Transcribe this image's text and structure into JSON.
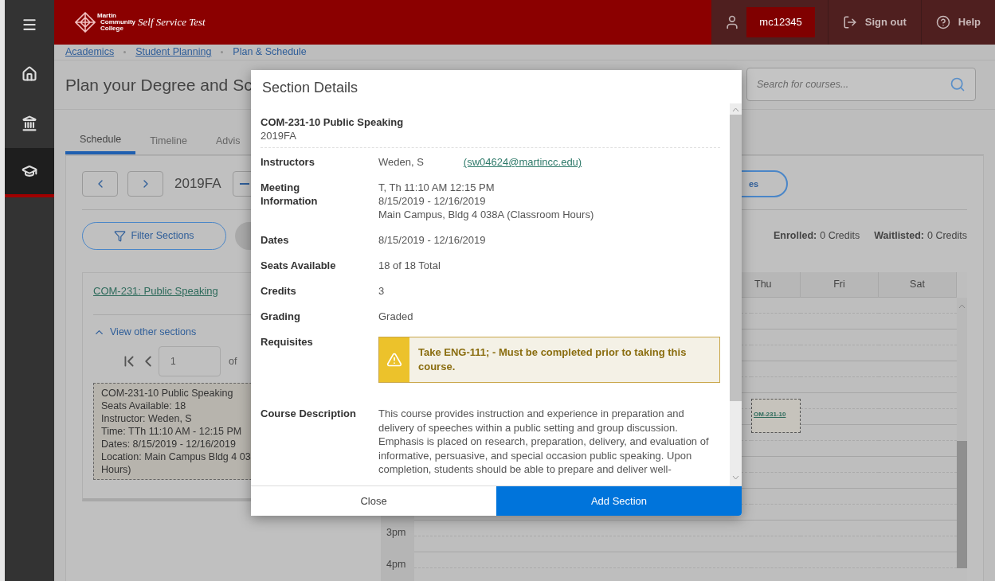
{
  "sidebar": {
    "items": [
      {
        "kind": "menu",
        "selected": false
      },
      {
        "kind": "home",
        "selected": false
      },
      {
        "kind": "institution",
        "selected": false
      },
      {
        "kind": "academics",
        "selected": true
      }
    ]
  },
  "header": {
    "logo_lines": [
      "Martin",
      "Community",
      "College"
    ],
    "app_name": "Self Service Test",
    "user": "mc12345",
    "sign_out": "Sign out",
    "help": "Help"
  },
  "breadcrumbs": [
    {
      "label": "Academics",
      "selected": false
    },
    {
      "label": "Student Planning",
      "selected": false
    },
    {
      "label": "Plan & Schedule",
      "selected": true
    }
  ],
  "page_title": "Plan your Degree and Sc",
  "search": {
    "placeholder": "Search for courses..."
  },
  "tabs": [
    {
      "label": "Schedule",
      "selected": true
    },
    {
      "label": "Timeline",
      "selected": false
    },
    {
      "label": "Advis",
      "selected": false
    }
  ],
  "term": "2019FA",
  "partial_button": "es",
  "filter_button": "Filter Sections",
  "credits": [
    {
      "label": "Enrolled:",
      "value": "0 Credits"
    },
    {
      "label": "Waitlisted:",
      "value": "0 Credits"
    }
  ],
  "course_card": {
    "title": "COM-231: Public Speaking",
    "toggle": "View other sections",
    "expanded": true,
    "page": "1",
    "page_of": "of",
    "section_lines": [
      "COM-231-10 Public Speaking",
      "Seats Available: 18",
      "Instructor: Weden, S",
      "Time: TTh 11:10 AM - 12:15 PM",
      "Dates: 8/15/2019 - 12/16/2019",
      "Location: Main Campus Bldg 4 03",
      "Hours)"
    ]
  },
  "calendar": {
    "days": [
      {
        "label": "Thu",
        "events": [
          {
            "label": "OM-231-10"
          }
        ]
      },
      {
        "label": "Fri"
      },
      {
        "label": "Sat"
      }
    ],
    "times": [
      "3pm",
      "4pm"
    ]
  },
  "modal": {
    "title": "Section Details",
    "course": "COM-231-10 Public Speaking",
    "term": "2019FA",
    "rows": [
      {
        "kind": "instructor",
        "label": "Instructors",
        "value": "Weden, S",
        "email": "(sw04624@martincc.edu)"
      },
      {
        "kind": "lines",
        "label": "Meeting Information",
        "lines": [
          "T, Th 11:10 AM 12:15 PM",
          "8/15/2019 - 12/16/2019",
          "Main Campus, Bldg 4 038A (Classroom Hours)"
        ]
      },
      {
        "kind": "text",
        "label": "Dates",
        "value": "8/15/2019 - 12/16/2019"
      },
      {
        "kind": "text",
        "label": "Seats Available",
        "value": "18 of 18 Total"
      },
      {
        "kind": "text",
        "label": "Credits",
        "value": "3"
      },
      {
        "kind": "text",
        "label": "Grading",
        "value": "Graded"
      },
      {
        "kind": "warning",
        "label": "Requisites",
        "value": "Take ENG-111; - Must be completed prior to taking this course."
      },
      {
        "kind": "description",
        "label": "Course Description",
        "value": "This course provides instruction and experience in preparation and delivery of speeches within a public setting and group discussion. Emphasis is placed on research, preparation, delivery, and evaluation of informative, persuasive, and special occasion public speaking. Upon completion, students should be able to prepare and deliver well-"
      }
    ],
    "buttons": [
      {
        "label": "Close",
        "kind": "secondary"
      },
      {
        "label": "Add Section",
        "kind": "primary"
      }
    ]
  }
}
